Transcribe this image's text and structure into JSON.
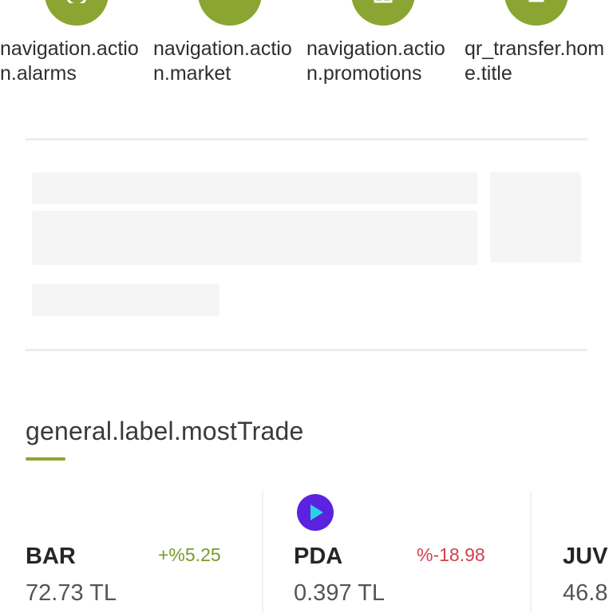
{
  "actions": [
    {
      "label": "navigation.action.alarms",
      "icon": "alarm-clock-icon"
    },
    {
      "label": "navigation.action.market",
      "icon": "market-icon"
    },
    {
      "label": "navigation.action.promotions",
      "icon": "gift-icon"
    },
    {
      "label": "qr_transfer.home.title",
      "icon": "qr-transfer-icon"
    }
  ],
  "colors": {
    "accent": "#8aa531",
    "positive": "#7a9a2a",
    "negative": "#d23f4f"
  },
  "most_traded": {
    "title": "general.label.mostTrade",
    "items": [
      {
        "symbol": "BAR",
        "price": "72.73 TL",
        "change": "+%5.25",
        "direction": "up"
      },
      {
        "symbol": "PDA",
        "price": "0.397 TL",
        "change": "%-18.98",
        "direction": "down",
        "icon": "play-logo-icon"
      },
      {
        "symbol": "JUV",
        "price": "46.8"
      }
    ]
  }
}
